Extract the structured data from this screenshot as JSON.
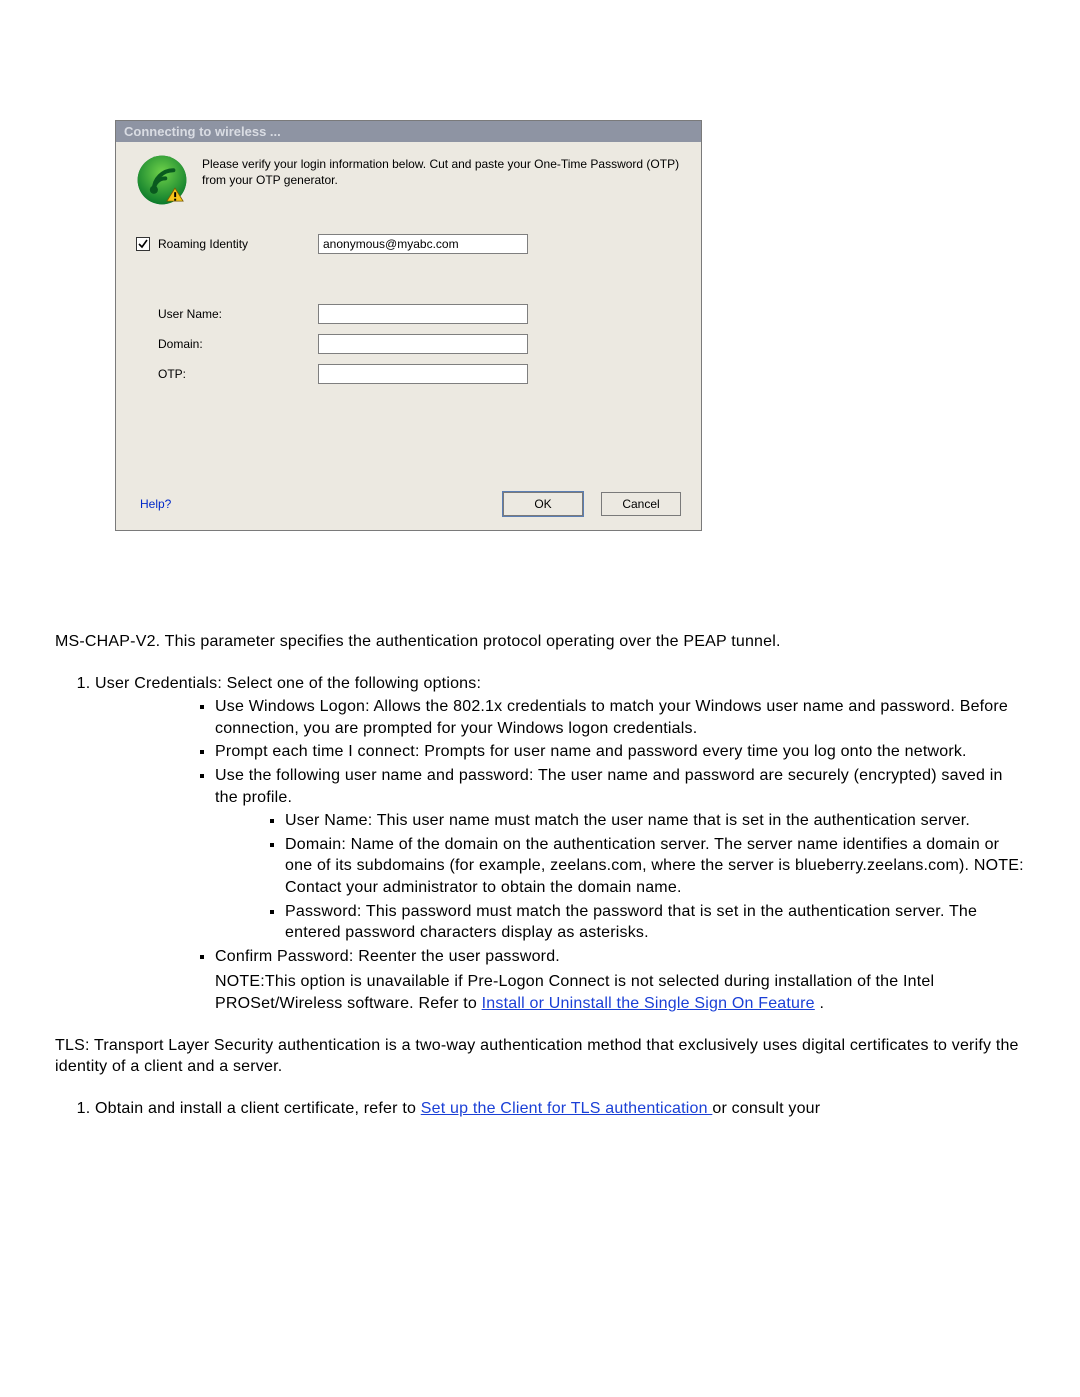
{
  "dialog": {
    "title": "Connecting to wireless ...",
    "instructions": "Please verify your login information below. Cut and paste your One-Time Password (OTP) from your OTP generator.",
    "roaming_identity_label": "Roaming Identity",
    "roaming_identity_value": "anonymous@myabc.com",
    "roaming_identity_checked": true,
    "user_name_label": "User Name:",
    "user_name_value": "",
    "domain_label": "Domain:",
    "domain_value": "",
    "otp_label": "OTP:",
    "otp_value": "",
    "help_label": "Help?",
    "ok_label": "OK",
    "cancel_label": "Cancel"
  },
  "doc": {
    "mschap_intro": "MS-CHAP-V2. This parameter specifies the authentication protocol operating over the PEAP tunnel.",
    "item1_lead": "User Credentials: Select one of the following options:",
    "opt1": "Use Windows Logon: Allows the 802.1x credentials to match your Windows user name and password. Before connection, you are prompted for your Windows logon credentials.",
    "opt2": "Prompt each time I connect: Prompts for user name and password every time you log onto the network.",
    "opt3": "Use the following user name and password: The user name and password are securely (encrypted) saved in the profile.",
    "sub_user": "User Name: This user name must match the user name that is set in the authentication server.",
    "sub_domain": "Domain: Name of the domain on the authentication server. The server name identifies a domain or one of its subdomains (for example, zeelans.com, where the server is blueberry.zeelans.com). NOTE: Contact your administrator to obtain the domain name.",
    "sub_password": "Password: This password must match the password that is set in the authentication server. The entered password characters display as asterisks.",
    "opt4": "Confirm Password: Reenter the user password.",
    "note_pre": "NOTE:This option is unavailable if Pre-Logon Connect is not selected during installation of the Intel PROSet/Wireless software. Refer to ",
    "note_link": "Install or Uninstall the Single Sign On Feature",
    "note_post": ".",
    "tls_intro": "TLS: Transport Layer Security authentication is a two-way authentication method that exclusively uses digital certificates to verify the identity of a client and a server.",
    "tls_item1_pre": "Obtain and install a client certificate, refer to ",
    "tls_item1_link": "Set up the Client for TLS authentication ",
    "tls_item1_post": "or consult your"
  }
}
